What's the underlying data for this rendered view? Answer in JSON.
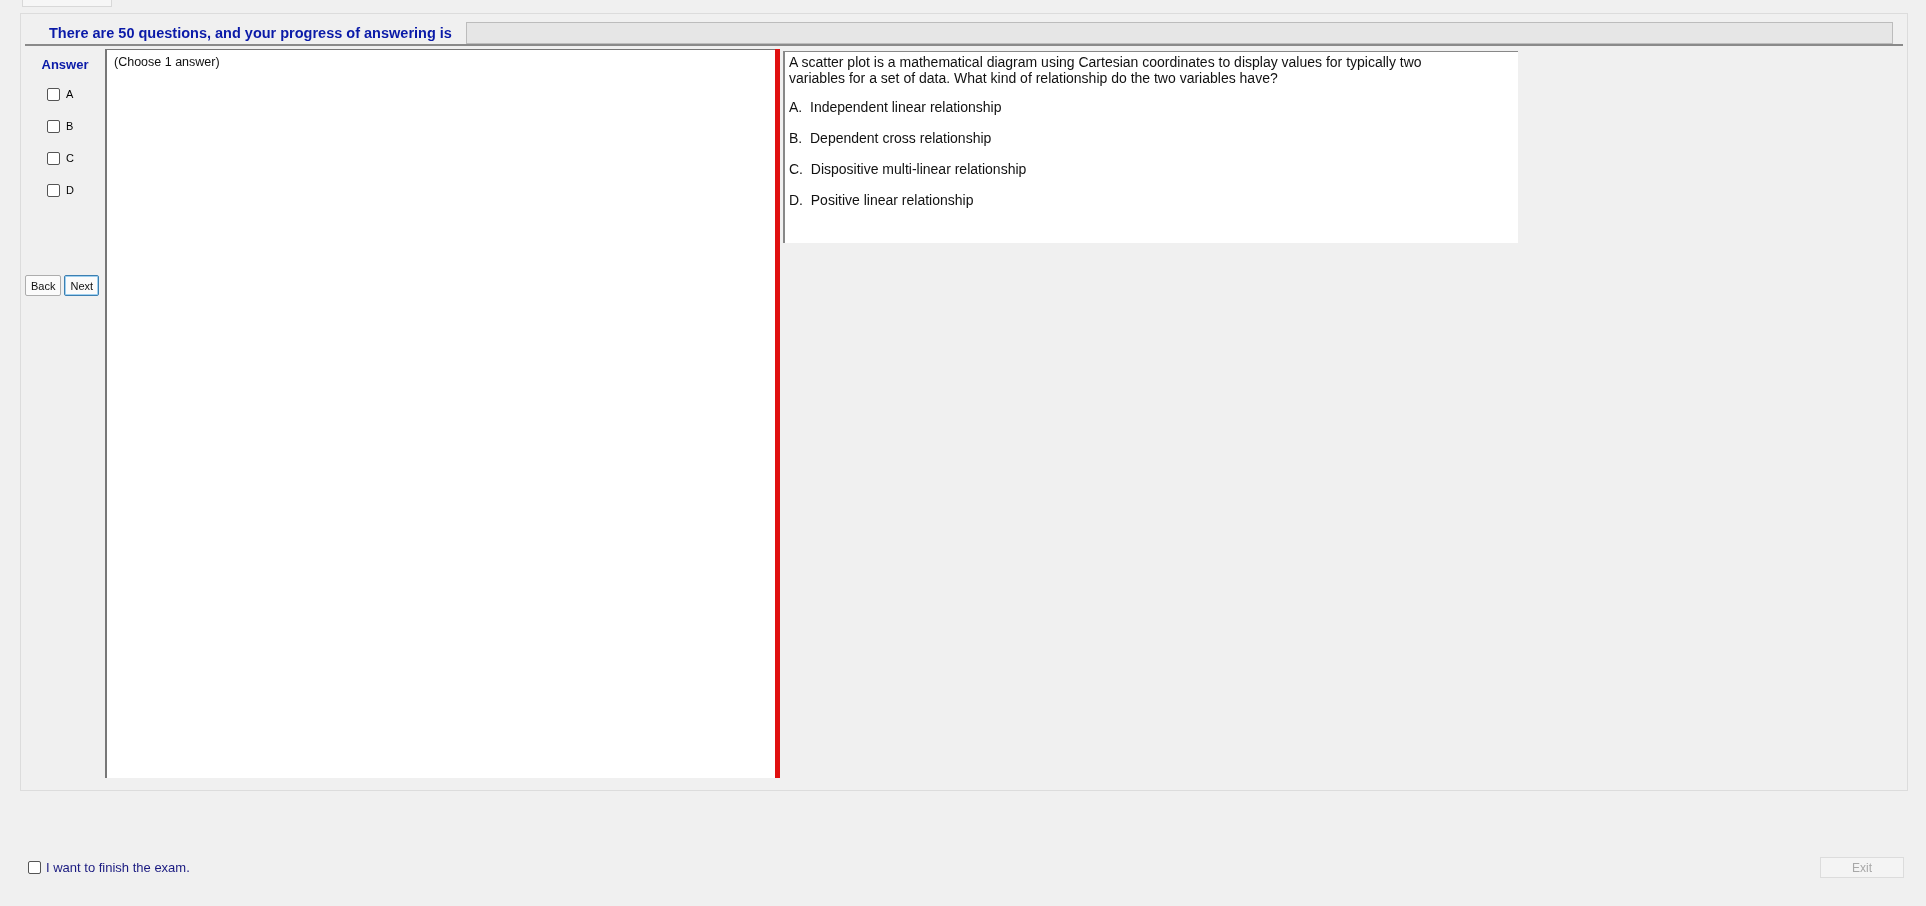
{
  "header": {
    "text": "There are 50 questions, and your progress of answering is",
    "progress": {
      "level": 0
    }
  },
  "answer_panel": {
    "title": "Answer",
    "options": [
      {
        "label": "A",
        "checked": false
      },
      {
        "label": "B",
        "checked": false
      },
      {
        "label": "C",
        "checked": false
      },
      {
        "label": "D",
        "checked": false
      }
    ],
    "buttons": [
      {
        "label": "Back",
        "focused": false
      },
      {
        "label": "Next",
        "focused": true
      }
    ]
  },
  "answer_note": "(Choose 1 answer)",
  "question": {
    "text": "A scatter plot is a mathematical diagram using Cartesian coordinates to display values for typically two variables for a set of data. What kind of relationship do the two variables have?",
    "choices": [
      "A.  Independent linear relationship",
      "B.  Dependent cross relationship",
      "C.  Dispositive multi-linear relationship",
      "D.  Positive linear relationship"
    ]
  },
  "finish": {
    "label": "I want to finish the exam.",
    "checked": false
  },
  "exit_button": {
    "label": "Exit",
    "disabled": true
  }
}
